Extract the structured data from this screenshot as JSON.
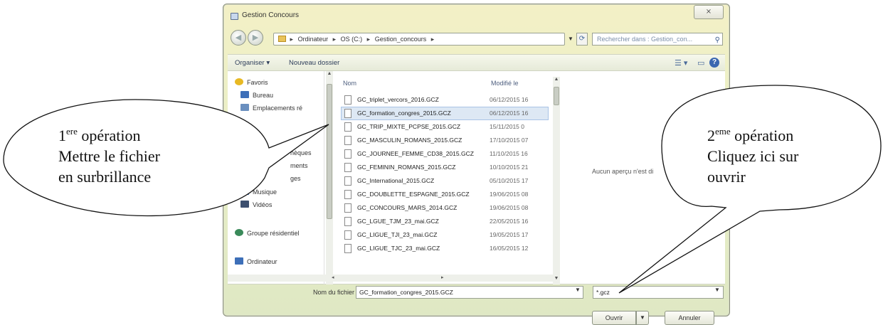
{
  "window": {
    "title": "Gestion Concours",
    "close_label": "⨯"
  },
  "address": {
    "crumbs": [
      "Ordinateur",
      "OS (C:)",
      "Gestion_concours"
    ]
  },
  "search": {
    "placeholder": "Rechercher dans : Gestion_con..."
  },
  "toolbar": {
    "organize": "Organiser ▾",
    "new_folder": "Nouveau dossier"
  },
  "sidebar": {
    "items": [
      {
        "label": "Favoris",
        "icon": "star-icon",
        "color": "#e8b923"
      },
      {
        "label": "Bureau",
        "icon": "desktop-icon",
        "color": "#3d6fb8"
      },
      {
        "label": "Emplacements ré",
        "icon": "recent-places-icon",
        "color": "#6a8fbf"
      },
      {
        "label": "hèques",
        "icon": "library-icon",
        "color": "#c9a24a"
      },
      {
        "label": "ments",
        "icon": "documents-icon",
        "color": "#c9a24a"
      },
      {
        "label": "ges",
        "icon": "images-icon",
        "color": "#c9a24a"
      },
      {
        "label": "Musique",
        "icon": "music-icon",
        "color": "#3d6fb8"
      },
      {
        "label": "Vidéos",
        "icon": "video-icon",
        "color": "#3d4f6f"
      },
      {
        "label": "Groupe résidentiel",
        "icon": "homegroup-icon",
        "color": "#3a8a5a"
      },
      {
        "label": "Ordinateur",
        "icon": "computer-icon",
        "color": "#3d6fb8"
      }
    ]
  },
  "columns": {
    "name": "Nom",
    "modified": "Modifié le"
  },
  "files": [
    {
      "name": "GC_triplet_vercors_2016.GCZ",
      "date": "06/12/2015 16",
      "selected": false
    },
    {
      "name": "GC_formation_congres_2015.GCZ",
      "date": "06/12/2015 16",
      "selected": true
    },
    {
      "name": "GC_TRIP_MIXTE_PCPSE_2015.GCZ",
      "date": "15/11/2015 0",
      "selected": false
    },
    {
      "name": "GC_MASCULIN_ROMANS_2015.GCZ",
      "date": "17/10/2015 07",
      "selected": false
    },
    {
      "name": "GC_JOURNEE_FEMME_CD38_2015.GCZ",
      "date": "11/10/2015 16",
      "selected": false
    },
    {
      "name": "GC_FEMININ_ROMANS_2015.GCZ",
      "date": "10/10/2015 21",
      "selected": false
    },
    {
      "name": "GC_International_2015.GCZ",
      "date": "05/10/2015 17",
      "selected": false
    },
    {
      "name": "GC_DOUBLETTE_ESPAGNE_2015.GCZ",
      "date": "19/06/2015 08",
      "selected": false
    },
    {
      "name": "GC_CONCOURS_MARS_2014.GCZ",
      "date": "19/06/2015 08",
      "selected": false
    },
    {
      "name": "GC_LGUE_TJM_23_mai.GCZ",
      "date": "22/05/2015 16",
      "selected": false
    },
    {
      "name": "GC_LIGUE_TJI_23_mai.GCZ",
      "date": "19/05/2015 17",
      "selected": false
    },
    {
      "name": "GC_LIGUE_TJC_23_mai.GCZ",
      "date": "16/05/2015 12",
      "selected": false
    }
  ],
  "preview": {
    "text": "Aucun aperçu n'est di"
  },
  "bottom": {
    "filename_label": "Nom du fichier :",
    "filename_value": "GC_formation_congres_2015.GCZ",
    "filter_value": "*.gcz",
    "open_label": "Ouvrir",
    "cancel_label": "Annuler"
  },
  "callouts": {
    "first": {
      "num": "1",
      "sup": "ere",
      "word": " opération",
      "line2": "Mettre le fichier",
      "line3": "en surbrillance"
    },
    "second": {
      "num": "2",
      "sup": "eme",
      "word": " opération",
      "line2": "Cliquez ici sur",
      "line3": "ouvrir"
    }
  }
}
